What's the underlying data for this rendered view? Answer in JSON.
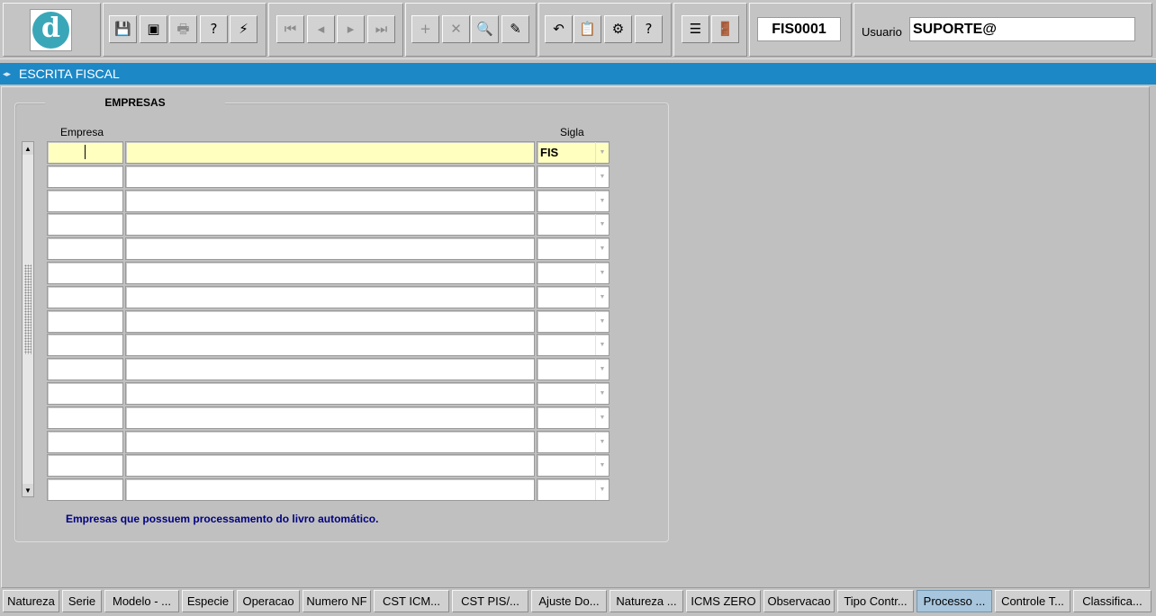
{
  "toolbar": {
    "logo_letter": "d",
    "buttons": [
      {
        "name": "save-icon",
        "glyph": "💾"
      },
      {
        "name": "window-icon",
        "glyph": "▣"
      },
      {
        "name": "print-icon",
        "glyph": "🖶"
      },
      {
        "name": "query-icon",
        "glyph": "?"
      },
      {
        "name": "execute-icon",
        "glyph": "⚡"
      },
      {
        "name": "first-record-icon",
        "glyph": "⏮"
      },
      {
        "name": "previous-record-icon",
        "glyph": "◂"
      },
      {
        "name": "next-record-icon",
        "glyph": "▸"
      },
      {
        "name": "last-record-icon",
        "glyph": "⏭"
      },
      {
        "name": "insert-record-icon",
        "glyph": "+"
      },
      {
        "name": "delete-record-icon",
        "glyph": "✕"
      },
      {
        "name": "search-record-icon",
        "glyph": "🔍"
      },
      {
        "name": "edit-record-icon",
        "glyph": "✎"
      },
      {
        "name": "undo-icon",
        "glyph": "↶"
      },
      {
        "name": "clipboard-icon",
        "glyph": "📋"
      },
      {
        "name": "tools-icon",
        "glyph": "⚙"
      },
      {
        "name": "help-icon",
        "glyph": "?"
      },
      {
        "name": "menu-icon",
        "glyph": "☰"
      },
      {
        "name": "exit-door-icon",
        "glyph": "🚪"
      }
    ],
    "form_code": "FIS0001",
    "user_label": "Usuario",
    "user_value": "SUPORTE@"
  },
  "window": {
    "title": "ESCRITA FISCAL"
  },
  "block": {
    "title": "EMPRESAS",
    "col_empresa": "Empresa",
    "col_sigla": "Sigla",
    "rows": [
      {
        "empresa": "",
        "nome": "",
        "sigla": "FIS"
      },
      {
        "empresa": "",
        "nome": "",
        "sigla": ""
      },
      {
        "empresa": "",
        "nome": "",
        "sigla": ""
      },
      {
        "empresa": "",
        "nome": "",
        "sigla": ""
      },
      {
        "empresa": "",
        "nome": "",
        "sigla": ""
      },
      {
        "empresa": "",
        "nome": "",
        "sigla": ""
      },
      {
        "empresa": "",
        "nome": "",
        "sigla": ""
      },
      {
        "empresa": "",
        "nome": "",
        "sigla": ""
      },
      {
        "empresa": "",
        "nome": "",
        "sigla": ""
      },
      {
        "empresa": "",
        "nome": "",
        "sigla": ""
      },
      {
        "empresa": "",
        "nome": "",
        "sigla": ""
      },
      {
        "empresa": "",
        "nome": "",
        "sigla": ""
      },
      {
        "empresa": "",
        "nome": "",
        "sigla": ""
      },
      {
        "empresa": "",
        "nome": "",
        "sigla": ""
      },
      {
        "empresa": "",
        "nome": "",
        "sigla": ""
      }
    ],
    "hint": "Empresas que possuem processamento do livro automático."
  },
  "tabs": [
    {
      "label": "Natureza",
      "active": false
    },
    {
      "label": "Serie",
      "active": false
    },
    {
      "label": "Modelo - ...",
      "active": false
    },
    {
      "label": "Especie",
      "active": false
    },
    {
      "label": "Operacao",
      "active": false
    },
    {
      "label": "Numero NF",
      "active": false
    },
    {
      "label": "CST ICM...",
      "active": false
    },
    {
      "label": "CST PIS/...",
      "active": false
    },
    {
      "label": "Ajuste Do...",
      "active": false
    },
    {
      "label": "Natureza ...",
      "active": false
    },
    {
      "label": "ICMS ZERO",
      "active": false
    },
    {
      "label": "Observacao",
      "active": false
    },
    {
      "label": "Tipo Contr...",
      "active": false
    },
    {
      "label": "Processo ...",
      "active": true
    },
    {
      "label": "Controle T...",
      "active": false
    },
    {
      "label": "Classifica...",
      "active": false
    }
  ]
}
